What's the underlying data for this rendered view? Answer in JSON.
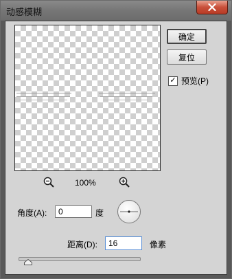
{
  "window": {
    "title": "动感模糊"
  },
  "buttons": {
    "ok_label": "确定",
    "reset_label": "复位"
  },
  "preview_toggle": {
    "label": "预览(P)",
    "checked": true,
    "check_glyph": "✓"
  },
  "zoom": {
    "level": "100%",
    "zoom_out_icon": "zoom-out-icon",
    "zoom_in_icon": "zoom-in-icon"
  },
  "angle": {
    "label": "角度(A):",
    "value": "0",
    "unit": "度"
  },
  "distance": {
    "label": "距离(D):",
    "value": "16",
    "unit": "像素"
  },
  "slider": {
    "value": 16
  },
  "colors": {
    "close_button": "#c9503a",
    "client_bg": "#d4d4d4"
  }
}
